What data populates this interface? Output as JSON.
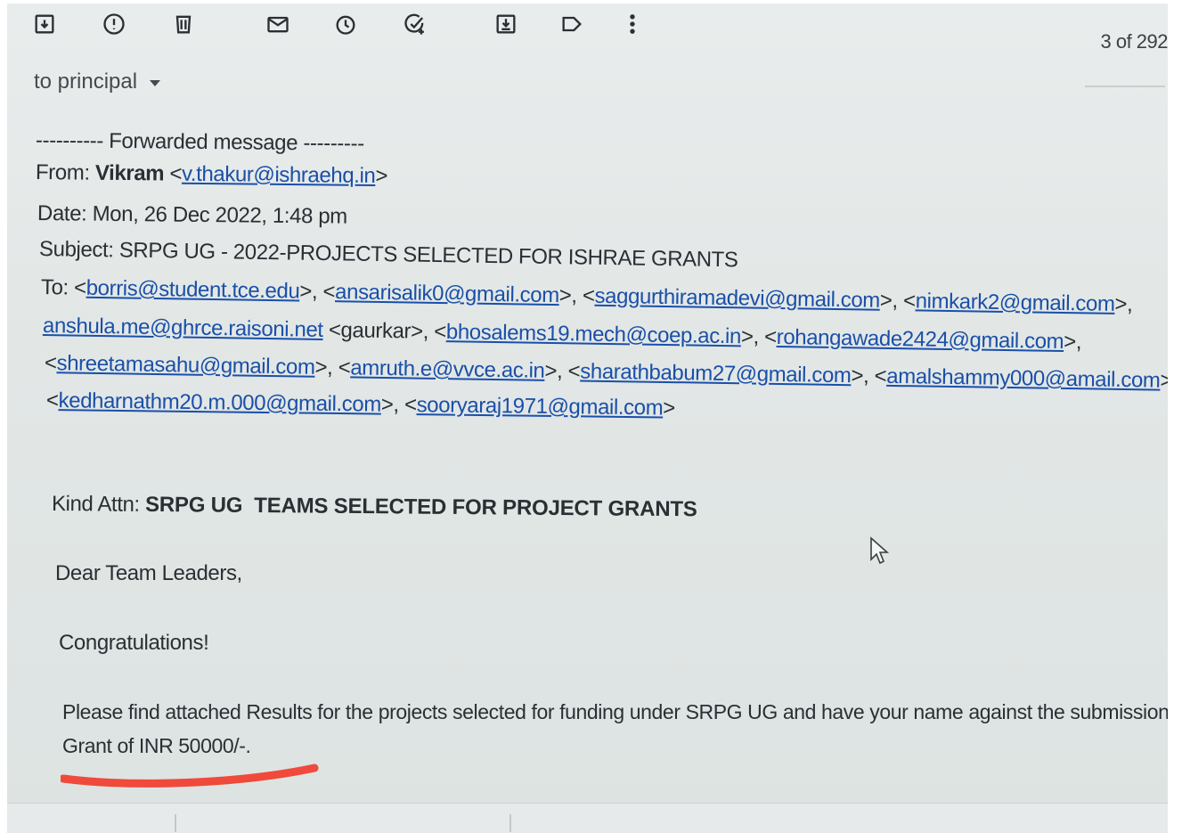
{
  "toolbar": {
    "icons": [
      "archive-icon",
      "report-spam-icon",
      "delete-icon",
      "mark-unread-icon",
      "snooze-icon",
      "add-task-icon",
      "move-to-icon",
      "label-icon",
      "more-icon"
    ],
    "counter": "3 of 292"
  },
  "recipient_line": "to principal",
  "forwarded": {
    "header": "---------- Forwarded message ---------",
    "from_label": "From:",
    "from_name": "Vikram",
    "from_email": "v.thakur@ishraehq.in",
    "date_label": "Date:",
    "date_value": "Mon, 26 Dec 2022, 1:48 pm",
    "subject_label": "Subject:",
    "subject_value": "SRPG UG - 2022-PROJECTS SELECTED FOR ISHRAE GRANTS",
    "to_label": "To:",
    "to_emails": [
      "borris@student.tce.edu",
      "ansarisalik0@gmail.com",
      "saggurthiramadevi@gmail.com",
      "nimkark2@gmail.com",
      "anshula.me@ghrce.raisoni.net",
      "bhosalems19.mech@coep.ac.in",
      "rohangawade2424@gmail.com",
      "shreetamasahu@gmail.com",
      "amruth.e@vvce.ac.in",
      "sharathbabum27@gmail.com",
      "amalshammy000@amail.com",
      "kedharnathm20.m.000@gmail.com",
      "sooryaraj1971@gmail.com"
    ],
    "gaurkar_text": "<gaurkar>"
  },
  "body": {
    "attn_label": "Kind Attn:",
    "attn_value": "SRPG UG  TEAMS SELECTED FOR PROJECT GRANTS",
    "greeting": "Dear Team Leaders,",
    "congrats": "Congratulations!",
    "para_line1": "Please find attached Results for the projects selected for funding under SRPG UG and have your name against the submission made for",
    "para_line2": "Grant of INR 50000/-."
  },
  "colors": {
    "link": "#1a4fa8",
    "text": "#2a2f33",
    "underline_mark": "#ef4a3b",
    "screen_bg": "#e4e8e7"
  }
}
